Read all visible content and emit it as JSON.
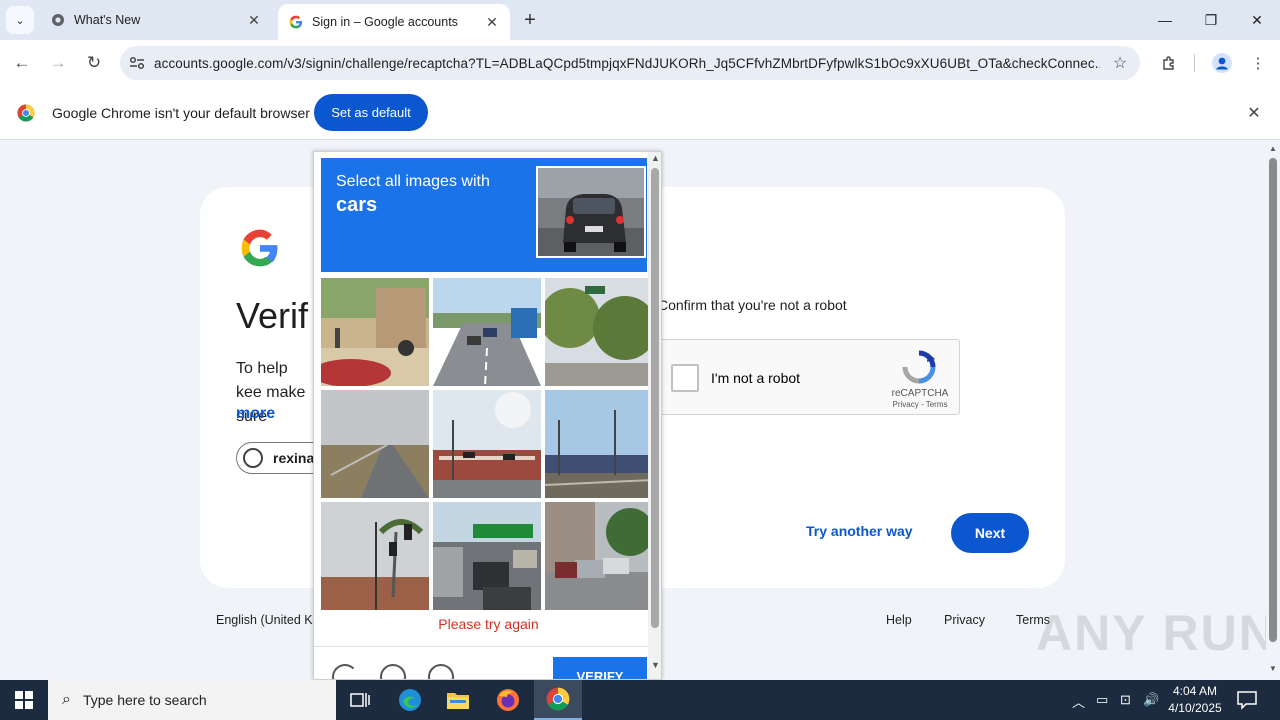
{
  "browser": {
    "tabs": [
      {
        "title": "What's New",
        "active": false
      },
      {
        "title": "Sign in – Google accounts",
        "active": true
      }
    ],
    "url": "accounts.google.com/v3/signin/challenge/recaptcha?TL=ADBLaQCpd5tmpjqxFNdJUKORh_Jq5CFfvhZMbrtDFyfpwlkS1bOc9xXU6UBt_OTa&checkConnec...",
    "window_controls": {
      "minimize": "—",
      "restore": "❐",
      "close": "✕"
    }
  },
  "infobar": {
    "message": "Google Chrome isn't your default browser",
    "button": "Set as default"
  },
  "signin": {
    "title": "Verif",
    "help_text": "To help kee make sure",
    "more_link": "more",
    "account": "rexina",
    "confirm_text": "Confirm that you're not a robot",
    "checkbox_label": "I'm not a robot",
    "recaptcha_brand": "reCAPTCHA",
    "recaptcha_links": "Privacy - Terms",
    "try_another": "Try another way",
    "next": "Next"
  },
  "footer": {
    "language": "English (United Ki",
    "links": [
      "Help",
      "Privacy",
      "Terms"
    ]
  },
  "watermark": "ANY RUN",
  "challenge": {
    "instruction": "Select all images with",
    "target": "cars",
    "tiles": [
      {
        "name": "tile-1",
        "scene": "street-pedestrian"
      },
      {
        "name": "tile-2",
        "scene": "highway-bus"
      },
      {
        "name": "tile-3",
        "scene": "trees-street"
      },
      {
        "name": "tile-4",
        "scene": "empty-road"
      },
      {
        "name": "tile-5",
        "scene": "intersection-building"
      },
      {
        "name": "tile-6",
        "scene": "rail-tracks"
      },
      {
        "name": "tile-7",
        "scene": "traffic-light-palms"
      },
      {
        "name": "tile-8",
        "scene": "highway-traffic"
      },
      {
        "name": "tile-9",
        "scene": "parked-cars"
      }
    ],
    "error": "Please try again",
    "verify": "VERIFY"
  },
  "taskbar": {
    "search_placeholder": "Type here to search",
    "time": "4:04 AM",
    "date": "4/10/2025"
  },
  "colors": {
    "accent": "#0b57d0",
    "recaptcha_blue": "#1a73e8",
    "error": "#d93025",
    "taskbar": "#1c2b3f"
  }
}
